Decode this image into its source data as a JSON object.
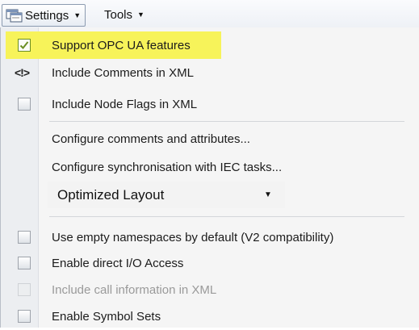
{
  "menubar": {
    "settings": {
      "label": "Settings",
      "icon": "settings-icon"
    },
    "tools": {
      "label": "Tools"
    }
  },
  "menu": {
    "items": [
      {
        "label": "Support OPC UA features",
        "control": "checkbox",
        "checked": true,
        "highlighted": true
      },
      {
        "label": "Include Comments in XML",
        "control": "icon",
        "icon_text": "<!>"
      },
      {
        "label": "Include Node Flags in XML",
        "control": "checkbox",
        "checked": false
      },
      {
        "label": "Configure comments and attributes...",
        "control": "none"
      },
      {
        "label": "Configure synchronisation with IEC tasks...",
        "control": "none"
      },
      {
        "label": "Use empty namespaces by default (V2 compatibility)",
        "control": "checkbox",
        "checked": false
      },
      {
        "label": "Enable direct I/O Access",
        "control": "checkbox",
        "checked": false
      },
      {
        "label": "Include call information in XML",
        "control": "checkbox",
        "checked": false,
        "disabled": true
      },
      {
        "label": "Enable Symbol Sets",
        "control": "checkbox",
        "checked": false
      }
    ],
    "layout_combo": {
      "value": "Optimized Layout"
    }
  },
  "colors": {
    "highlight": "#f7f35a",
    "check_mark": "#6b8e23",
    "gutter": "#eceef1"
  }
}
